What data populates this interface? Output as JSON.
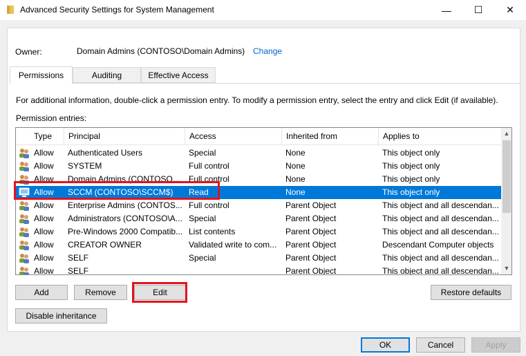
{
  "window": {
    "title": "Advanced Security Settings for System Management",
    "minimize_glyph": "—",
    "maximize_glyph": "☐",
    "close_glyph": "✕"
  },
  "owner": {
    "label": "Owner:",
    "value": "Domain Admins (CONTOSO\\Domain Admins)",
    "change_link": "Change"
  },
  "tabs": [
    {
      "label": "Permissions",
      "active": true
    },
    {
      "label": "Auditing",
      "active": false
    },
    {
      "label": "Effective Access",
      "active": false
    }
  ],
  "info_text": "For additional information, double-click a permission entry. To modify a permission entry, select the entry and click Edit (if available).",
  "entries_label": "Permission entries:",
  "columns": [
    "Type",
    "Principal",
    "Access",
    "Inherited from",
    "Applies to"
  ],
  "entries": [
    {
      "type": "Allow",
      "principal": "Authenticated Users",
      "access": "Special",
      "inherited": "None",
      "applies": "This object only",
      "icon": "users-icon"
    },
    {
      "type": "Allow",
      "principal": "SYSTEM",
      "access": "Full control",
      "inherited": "None",
      "applies": "This object only",
      "icon": "users-icon"
    },
    {
      "type": "Allow",
      "principal": "Domain Admins (CONTOSO...",
      "access": "Full control",
      "inherited": "None",
      "applies": "This object only",
      "icon": "users-icon"
    },
    {
      "type": "Allow",
      "principal": "SCCM (CONTOSO\\SCCM$)",
      "access": "Read",
      "inherited": "None",
      "applies": "This object only",
      "icon": "computer-icon",
      "selected": true
    },
    {
      "type": "Allow",
      "principal": "Enterprise Admins (CONTOS...",
      "access": "Full control",
      "inherited": "Parent Object",
      "applies": "This object and all descendan...",
      "icon": "users-icon"
    },
    {
      "type": "Allow",
      "principal": "Administrators (CONTOSO\\A...",
      "access": "Special",
      "inherited": "Parent Object",
      "applies": "This object and all descendan...",
      "icon": "users-icon"
    },
    {
      "type": "Allow",
      "principal": "Pre-Windows 2000 Compatib...",
      "access": "List contents",
      "inherited": "Parent Object",
      "applies": "This object and all descendan...",
      "icon": "users-icon"
    },
    {
      "type": "Allow",
      "principal": "CREATOR OWNER",
      "access": "Validated write to com...",
      "inherited": "Parent Object",
      "applies": "Descendant Computer objects",
      "icon": "users-icon"
    },
    {
      "type": "Allow",
      "principal": "SELF",
      "access": "Special",
      "inherited": "Parent Object",
      "applies": "This object and all descendan...",
      "icon": "users-icon"
    },
    {
      "type": "Allow",
      "principal": "SELF",
      "access": "",
      "inherited": "Parent Object",
      "applies": "This object and all descendan...",
      "icon": "users-icon"
    }
  ],
  "buttons": {
    "add": "Add",
    "remove": "Remove",
    "edit": "Edit",
    "restore_defaults": "Restore defaults",
    "disable_inheritance": "Disable inheritance",
    "ok": "OK",
    "cancel": "Cancel",
    "apply": "Apply"
  },
  "scrollbar": {
    "up_glyph": "▲",
    "down_glyph": "▼"
  },
  "colors": {
    "selection": "#0078d7",
    "highlight_annotation": "#e0141e",
    "link": "#0066cc"
  }
}
